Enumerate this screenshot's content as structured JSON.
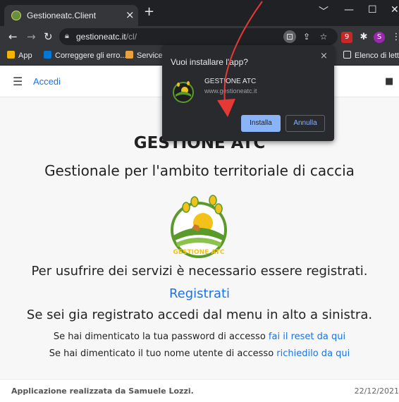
{
  "browser": {
    "tab_title": "Gestioneatc.Client",
    "tab_close": "×",
    "new_tab": "+",
    "window_controls": [
      "﹀",
      "—",
      "☐",
      "✕"
    ],
    "url_host": "gestioneatc.it",
    "url_path": "/cl/",
    "bookmarks": [
      {
        "label": "App",
        "icon": "apps-grid-icon",
        "color": "#f4b400"
      },
      {
        "label": "Correggere gli erro...",
        "icon": "windows-icon",
        "color": "#0078d4"
      },
      {
        "label": "ServiceV",
        "icon": "bookmark-page-icon",
        "color": "#e8a33d"
      },
      {
        "label": "Elenco di lettura",
        "icon": "reading-list-icon",
        "color": "#e8eaed"
      }
    ],
    "profile_initial": "S",
    "extension_badge": "9"
  },
  "app": {
    "menu_label": "Accedi",
    "title": "GESTIONE ATC",
    "subtitle": "Gestionale per l'ambito territoriale di caccia",
    "logo_text": "GESTIONE ATC",
    "register_prompt": "Per usufrire dei servizi è necessario essere registrati.",
    "register_link": "Registrati",
    "login_hint": "Se sei gia registrato accedi dal menu in alto a sinistra.",
    "password_reset_text": "Se hai dimenticato la tua password di accesso",
    "password_reset_link": "fai il reset da qui",
    "username_text": "Se hai dimenticato il tuo nome utente di accesso",
    "username_link": "richiedilo da qui",
    "footer_credit": "Applicazione realizzata da Samuele Lozzi.",
    "footer_date": "22/12/2021"
  },
  "install_popup": {
    "title": "Vuoi installare l'app?",
    "app_name": "GESTIONE ATC",
    "app_url": "www.gestioneatc.it",
    "install_label": "Installa",
    "cancel_label": "Annulla",
    "close": "×"
  },
  "colors": {
    "accent": "#1a73e8",
    "annotation_arrow": "#e53935",
    "logo_green": "#5a9a2a",
    "logo_yellow": "#f2c21b"
  }
}
